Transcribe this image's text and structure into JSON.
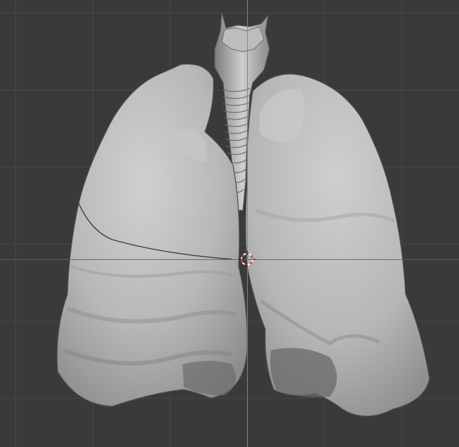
{
  "viewport": {
    "object_name": "lungs-trachea-model",
    "shading": "solid",
    "colors": {
      "background": "#3a3a3a",
      "grid_minor": "#3f3f3f",
      "grid_major": "#484848",
      "x_axis": "#b43c46",
      "y_axis": "#6e9a2e",
      "mesh_light": "#d2d2d2",
      "mesh_mid": "#a8a8a8",
      "mesh_shadow": "#6a6a6a",
      "cursor_red": "#e03030",
      "cursor_white": "#ffffff"
    },
    "icons": {
      "cursor": "3d-cursor-icon"
    }
  }
}
